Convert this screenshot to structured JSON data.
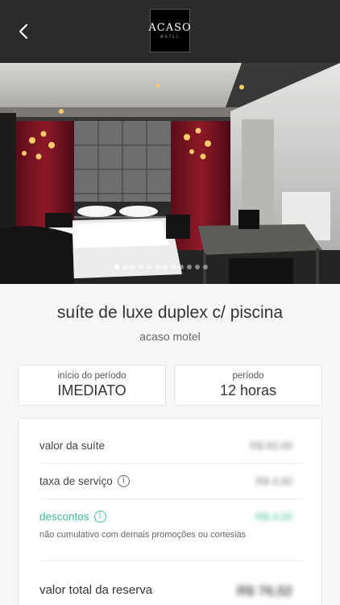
{
  "header": {
    "back_icon": "chevron-left-icon",
    "logo_text": "ACASO",
    "logo_sub": "MOTEL"
  },
  "gallery": {
    "total_images": 12,
    "active_index": 0
  },
  "room": {
    "title": "suíte de luxe duplex c/ piscina",
    "motel_name": "acaso motel"
  },
  "booking": {
    "start_label": "início do período",
    "start_value": "IMEDIATO",
    "period_label": "período",
    "period_value": "12 horas"
  },
  "pricing": {
    "suite_label": "valor da suíte",
    "suite_value": "R$ 82,00",
    "service_label": "taxa de serviço",
    "service_value": "R$ 4,60",
    "discount_label": "descontos",
    "discount_value": "-R$ 4,00",
    "discount_note": "não cumulativo com demais promoções ou cortesias",
    "total_label": "valor total da reserva",
    "total_value": "R$ 76,52"
  },
  "colors": {
    "header_bg": "#2b2b2b",
    "discount_green": "#3fbf92",
    "page_bg": "#f6f6f7"
  }
}
